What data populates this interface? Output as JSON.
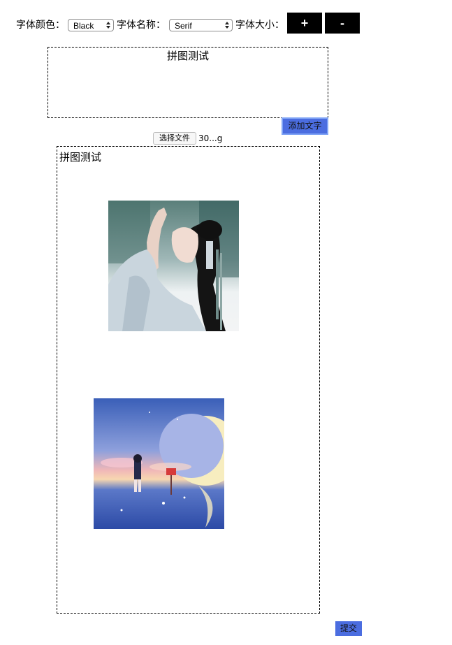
{
  "toolbar": {
    "font_color_label": "字体颜色：",
    "font_color_value": "Black",
    "font_name_label": "字体名称：",
    "font_name_value": "Serif",
    "font_size_label": "字体大小：",
    "increase_label": "+",
    "decrease_label": "-"
  },
  "text_box": {
    "text": "拼图测试",
    "add_text_button": "添加文字"
  },
  "file_input": {
    "button_label": "选择文件",
    "file_name": "30...g"
  },
  "canvas": {
    "title_text": "拼图测试",
    "images": [
      "girl-photo",
      "moon-sea-illustration"
    ]
  },
  "submit_button": "提交",
  "colors": {
    "accent_button": "#4b6de0",
    "control_button": "#000000"
  }
}
